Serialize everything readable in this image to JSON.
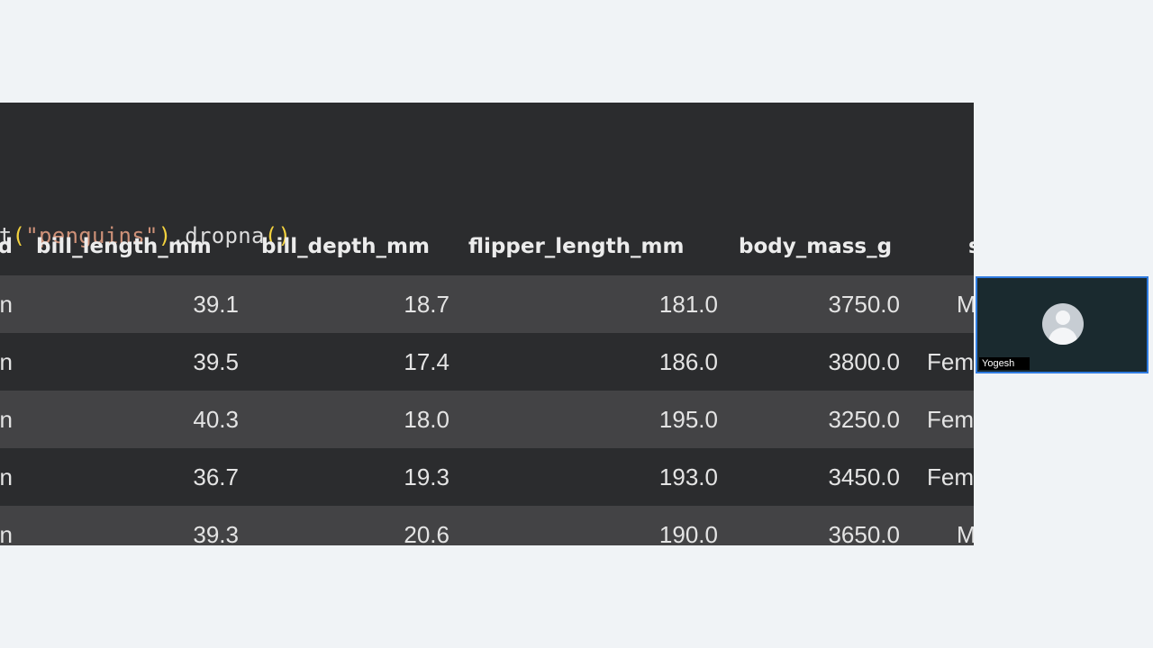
{
  "code_line": {
    "prefix": "et",
    "open_paren": "(",
    "string": "\"penguins\"",
    "close_paren": ")",
    "method": ".dropna",
    "call_parens": "()"
  },
  "table": {
    "headers": [
      "d",
      "bill_length_mm",
      "bill_depth_mm",
      "flipper_length_mm",
      "body_mass_g",
      "s"
    ],
    "rows": [
      [
        "n",
        "39.1",
        "18.7",
        "181.0",
        "3750.0",
        "M"
      ],
      [
        "n",
        "39.5",
        "17.4",
        "186.0",
        "3800.0",
        "Fem"
      ],
      [
        "n",
        "40.3",
        "18.0",
        "195.0",
        "3250.0",
        "Fem"
      ],
      [
        "n",
        "36.7",
        "19.3",
        "193.0",
        "3450.0",
        "Fem"
      ],
      [
        "n",
        "39.3",
        "20.6",
        "190.0",
        "3650.0",
        "M"
      ]
    ]
  },
  "participant": {
    "name": "Yogesh",
    "icon": "user-avatar-icon"
  },
  "colors": {
    "page_bg": "#f0f3f6",
    "share_bg": "#2b2c2e",
    "row_alt_bg": "#434345",
    "participant_border": "#2f7be0"
  }
}
